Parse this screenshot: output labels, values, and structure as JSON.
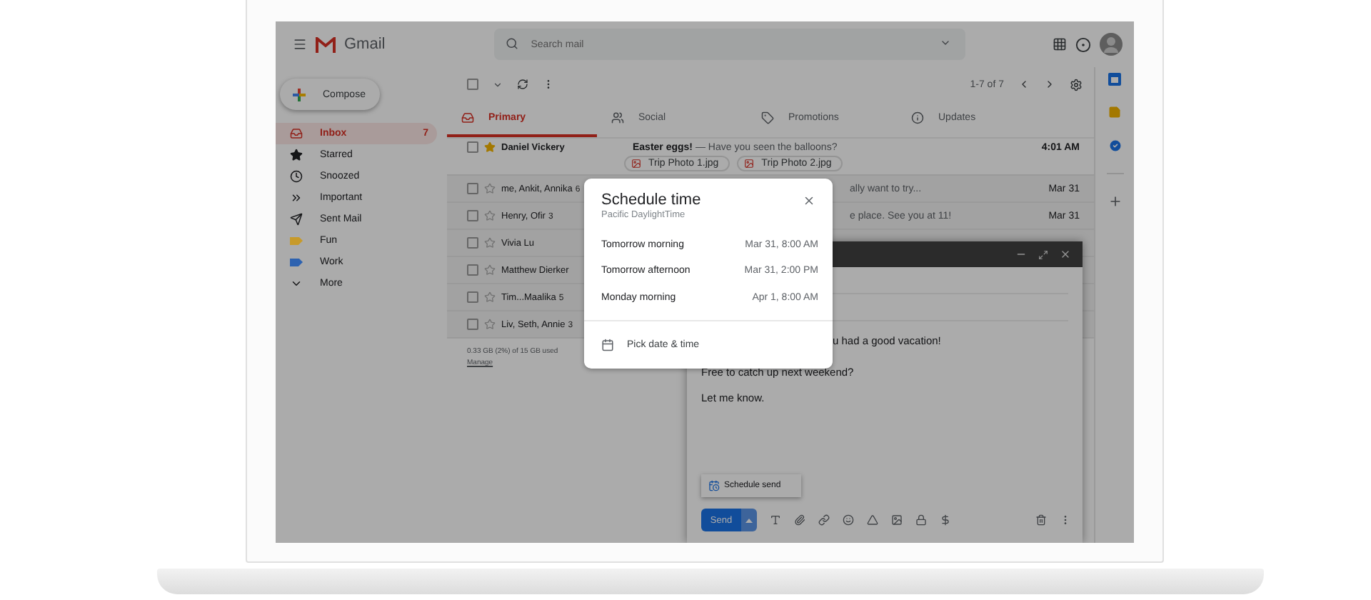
{
  "app": {
    "name": "Gmail"
  },
  "search": {
    "placeholder": "Search mail"
  },
  "compose_button": {
    "label": "Compose"
  },
  "sidebar": {
    "items": [
      {
        "kind": "inbox",
        "label": "Inbox",
        "count": "7",
        "selected": true
      },
      {
        "kind": "star",
        "label": "Starred",
        "selected": false
      },
      {
        "kind": "clock",
        "label": "Snoozed",
        "selected": false
      },
      {
        "kind": "important",
        "label": "Important",
        "selected": false
      },
      {
        "kind": "send",
        "label": "Sent Mail",
        "selected": false
      },
      {
        "kind": "label",
        "label": "Fun",
        "color": "#c79a2a",
        "selected": false
      },
      {
        "kind": "label",
        "label": "Work",
        "color": "#2d62b0",
        "selected": false
      },
      {
        "kind": "more",
        "label": "More",
        "selected": false
      }
    ]
  },
  "toolbar": {
    "select_all": {
      "checked": false
    },
    "pagination": "1-7 of 7"
  },
  "tabs": [
    {
      "kind": "inbox",
      "label": "Primary",
      "selected": true
    },
    {
      "kind": "people",
      "label": "Social",
      "selected": false
    },
    {
      "kind": "tag",
      "label": "Promotions",
      "selected": false
    },
    {
      "kind": "info",
      "label": "Updates",
      "selected": false
    }
  ],
  "rows": [
    {
      "sender": "Daniel Vickery",
      "checked": false,
      "starred": true,
      "unread": true,
      "subject": "Easter eggs!",
      "snippet": " — Have you seen the balloons?",
      "attachments": [
        "Trip Photo 1.jpg",
        "Trip Photo 2.jpg"
      ],
      "time": "4:01 AM"
    },
    {
      "sender": "me, Ankit, Annika",
      "count": "6",
      "checked": false,
      "starred": false,
      "unread": false,
      "snippet": "ally want to try...",
      "time": "Mar 31"
    },
    {
      "sender": "Henry, Ofir",
      "count": "3",
      "checked": false,
      "starred": false,
      "unread": false,
      "snippet": "e place. See you at 11!",
      "time": "Mar 31"
    },
    {
      "sender": "Vivia Lu",
      "checked": false,
      "starred": false,
      "unread": false
    },
    {
      "sender": "Matthew Dierker",
      "checked": false,
      "starred": false,
      "unread": false
    },
    {
      "sender": "Tim...Maalika",
      "count": "5",
      "checked": false,
      "starred": false,
      "unread": false
    },
    {
      "sender": "Liv, Seth, Annie",
      "count": "3",
      "checked": false,
      "starred": false,
      "unread": false
    }
  ],
  "storage": {
    "usage": "0.33 GB (2%) of 15 GB used",
    "link": "Manage"
  },
  "compose": {
    "lines": [
      "u had a good vacation!",
      "Free to catch up next weekend?",
      "Let me know."
    ],
    "menu_item": "Schedule send",
    "send_label": "Send"
  },
  "dialog": {
    "title": "Schedule time",
    "timezone": "Pacific DaylightTime",
    "options": [
      {
        "label": "Tomorrow morning",
        "time": "Mar 31, 8:00 AM"
      },
      {
        "label": "Tomorrow afternoon",
        "time": "Mar 31, 2:00 PM"
      },
      {
        "label": "Monday morning",
        "time": "Apr 1, 8:00 AM"
      }
    ],
    "custom": "Pick date & time"
  }
}
